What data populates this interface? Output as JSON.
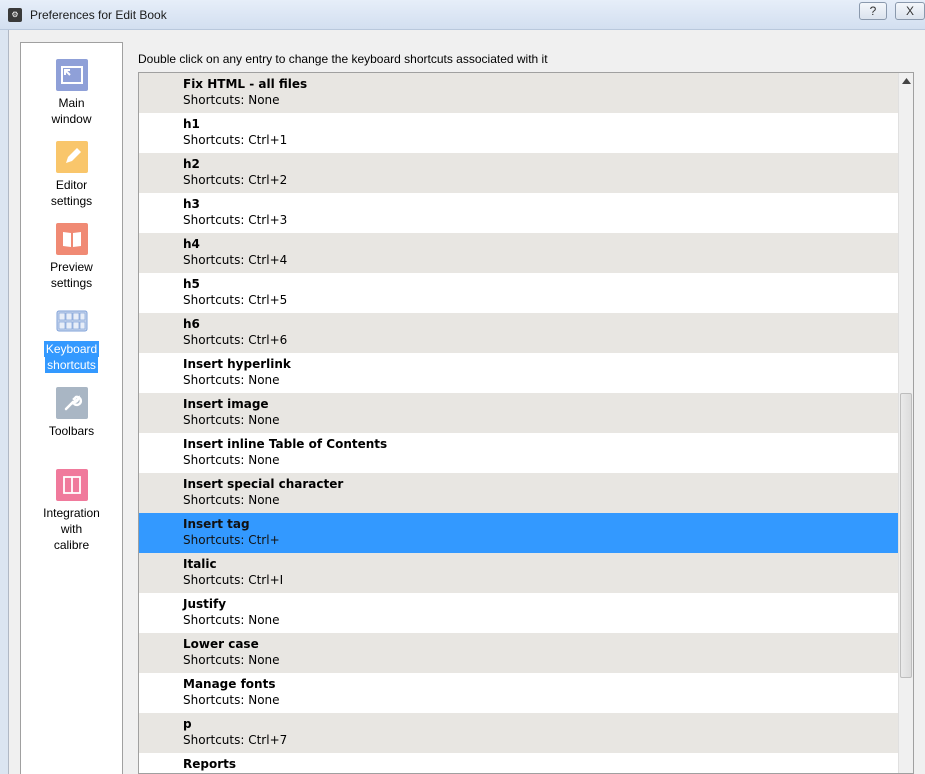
{
  "window": {
    "title": "Preferences for Edit Book",
    "help_label": "?",
    "close_label": "X"
  },
  "sidebar": {
    "items": [
      {
        "label_line1": "Main",
        "label_line2": "window",
        "icon": "main-window-icon",
        "color": "#8fa0d8"
      },
      {
        "label_line1": "Editor",
        "label_line2": "settings",
        "icon": "pencil-icon",
        "color": "#f9c66b"
      },
      {
        "label_line1": "Preview",
        "label_line2": "settings",
        "icon": "book-icon",
        "color": "#f08a74"
      },
      {
        "label_line1": "Keyboard",
        "label_line2": "shortcuts",
        "icon": "keyboard-icon",
        "color": "#7fa1d9",
        "selected": true
      },
      {
        "label_line1": "Toolbars",
        "label_line2": "",
        "icon": "wrench-icon",
        "color": "#a9b6c4"
      },
      {
        "label_line1": "Integration",
        "label_line2": "with",
        "label_line3": "calibre",
        "icon": "integration-icon",
        "color": "#f07a9c"
      }
    ]
  },
  "hint_text": "Double click on any entry to change the keyboard shortcuts associated with it",
  "shortcuts": [
    {
      "name": "Fix HTML - all files",
      "shortcut": "Shortcuts: None"
    },
    {
      "name": "h1",
      "shortcut": "Shortcuts: Ctrl+1"
    },
    {
      "name": "h2",
      "shortcut": "Shortcuts: Ctrl+2"
    },
    {
      "name": "h3",
      "shortcut": "Shortcuts: Ctrl+3"
    },
    {
      "name": "h4",
      "shortcut": "Shortcuts: Ctrl+4"
    },
    {
      "name": "h5",
      "shortcut": "Shortcuts: Ctrl+5"
    },
    {
      "name": "h6",
      "shortcut": "Shortcuts: Ctrl+6"
    },
    {
      "name": "Insert hyperlink",
      "shortcut": "Shortcuts: None"
    },
    {
      "name": "Insert image",
      "shortcut": "Shortcuts: None"
    },
    {
      "name": "Insert inline Table of Contents",
      "shortcut": "Shortcuts: None"
    },
    {
      "name": "Insert special character",
      "shortcut": "Shortcuts: None"
    },
    {
      "name": "Insert tag",
      "shortcut": "Shortcuts: Ctrl+",
      "selected": true
    },
    {
      "name": "Italic",
      "shortcut": "Shortcuts: Ctrl+I"
    },
    {
      "name": "Justify",
      "shortcut": "Shortcuts: None"
    },
    {
      "name": "Lower case",
      "shortcut": "Shortcuts: None"
    },
    {
      "name": "Manage fonts",
      "shortcut": "Shortcuts: None"
    },
    {
      "name": "p",
      "shortcut": "Shortcuts: Ctrl+7"
    },
    {
      "name": "Reports",
      "shortcut": ""
    }
  ],
  "colors": {
    "selection": "#3399ff",
    "alt_row": "#e8e6e2"
  }
}
